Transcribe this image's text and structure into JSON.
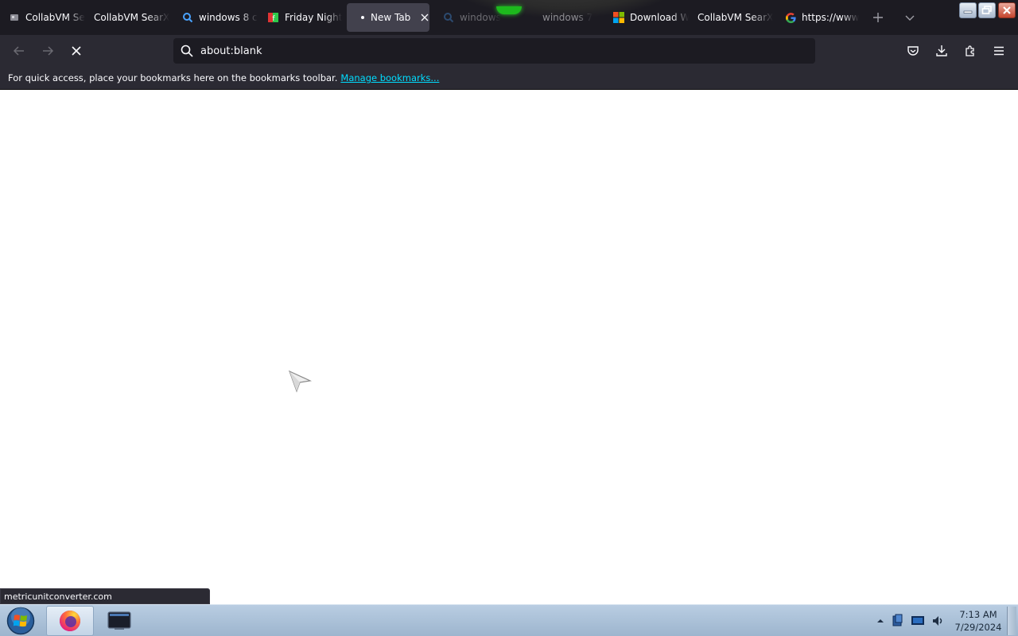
{
  "browser": {
    "tabs": [
      {
        "label": "CollabVM Se",
        "icon": "collabvm-icon"
      },
      {
        "label": "CollabVM SearX",
        "icon": "none"
      },
      {
        "label": "windows 8 c",
        "icon": "search-icon"
      },
      {
        "label": "Friday Night",
        "icon": "fnf-icon"
      },
      {
        "label": "New Tab",
        "icon": "loading-dot",
        "active": true
      },
      {
        "label": "windows",
        "icon": "search-icon"
      },
      {
        "label": "windows 7",
        "icon": "none"
      },
      {
        "label": "Download W",
        "icon": "microsoft-icon"
      },
      {
        "label": "CollabVM SearX",
        "icon": "none"
      },
      {
        "label": "https://www",
        "icon": "google-icon"
      }
    ],
    "url": "about:blank",
    "bookmarks_bar": {
      "text": "For quick access, place your bookmarks here on the bookmarks toolbar.",
      "link": "Manage bookmarks..."
    },
    "status_text": "metricunitconverter.com",
    "colors": {
      "toolbar": "#2b2a33",
      "tabstrip": "#1c1b22",
      "link": "#00ddff"
    }
  },
  "taskbar": {
    "time": "7:13 AM",
    "date": "7/29/2024",
    "apps": [
      "firefox-icon",
      "terminal-icon"
    ]
  }
}
